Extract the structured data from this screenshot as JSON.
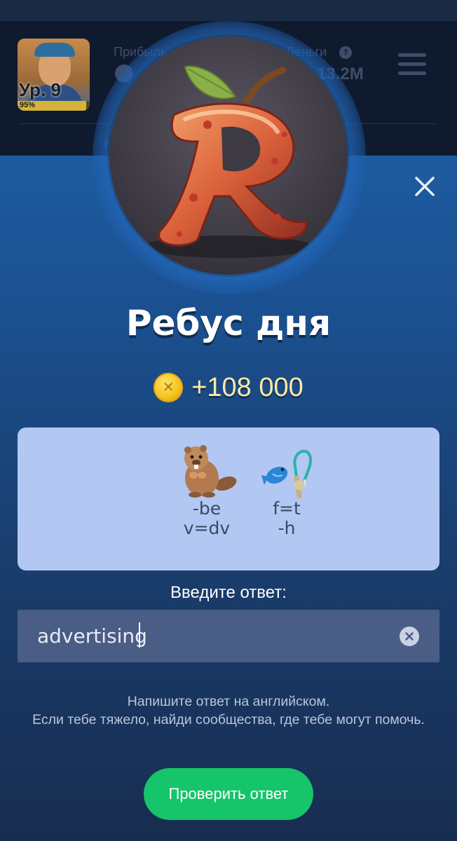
{
  "background": {
    "level_label": "Ур. 9",
    "level_progress_label": "95%",
    "level_progress": 0.95,
    "profit_label": "Прибыль",
    "money_label": "Деньги",
    "money_value": "13.2M",
    "info_icon": "?"
  },
  "modal": {
    "title": "Ребус дня",
    "reward_amount": "+108 000",
    "reward_icon": "coin-icon",
    "rebus": {
      "items": [
        {
          "icon": "beaver-icon",
          "hint_line1": "-be",
          "hint_line2": "v=dv"
        },
        {
          "icon": "fishing-rod-icon",
          "hint_line1": "f=t",
          "hint_line2": "-h"
        }
      ]
    },
    "answer_label": "Введите ответ:",
    "answer_value": "advertising",
    "hint_line1": "Напишите ответ на английском.",
    "hint_line2": "Если тебе тяжело, найди сообщества, где тебе могут помочь.",
    "check_button": "Проверить ответ",
    "colors": {
      "accent_green": "#16c46a",
      "coin_gold": "#f5c21e",
      "card_bg": "#b2c7f2"
    }
  }
}
